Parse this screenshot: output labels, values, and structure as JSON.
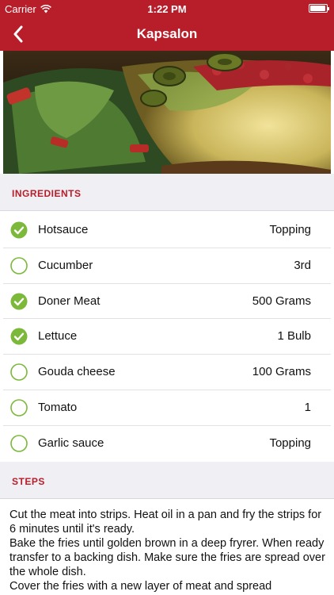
{
  "status_bar": {
    "carrier": "Carrier",
    "time": "1:22 PM",
    "battery_level": 0.95
  },
  "nav": {
    "title": "Kapsalon",
    "back_icon": "chevron-left-icon"
  },
  "hero": {
    "image": "photo of kapsalon dish"
  },
  "ingredients_section": {
    "title": "INGREDIENTS",
    "items": [
      {
        "name": "Hotsauce",
        "quantity": "Topping",
        "checked": true
      },
      {
        "name": "Cucumber",
        "quantity": "3rd",
        "checked": false
      },
      {
        "name": "Doner Meat",
        "quantity": "500 Grams",
        "checked": true
      },
      {
        "name": "Lettuce",
        "quantity": "1 Bulb",
        "checked": true
      },
      {
        "name": "Gouda cheese",
        "quantity": "100 Grams",
        "checked": false
      },
      {
        "name": "Tomato",
        "quantity": "1",
        "checked": false
      },
      {
        "name": "Garlic sauce",
        "quantity": "Topping",
        "checked": false
      }
    ]
  },
  "steps_section": {
    "title": "STEPS",
    "paragraphs": [
      "Cut the meat into strips. Heat oil in a pan and fry the strips for 6 minutes until it's ready.",
      "Bake the fries until golden brown in a deep fryrer. When ready transfer to a backing dish. Make sure the fries are spread over the whole dish.",
      "Cover the fries with a new layer of meat and spread"
    ]
  },
  "colors": {
    "brand": "#b81d2a",
    "check_green": "#7cb83a",
    "section_bg": "#efeff4"
  }
}
